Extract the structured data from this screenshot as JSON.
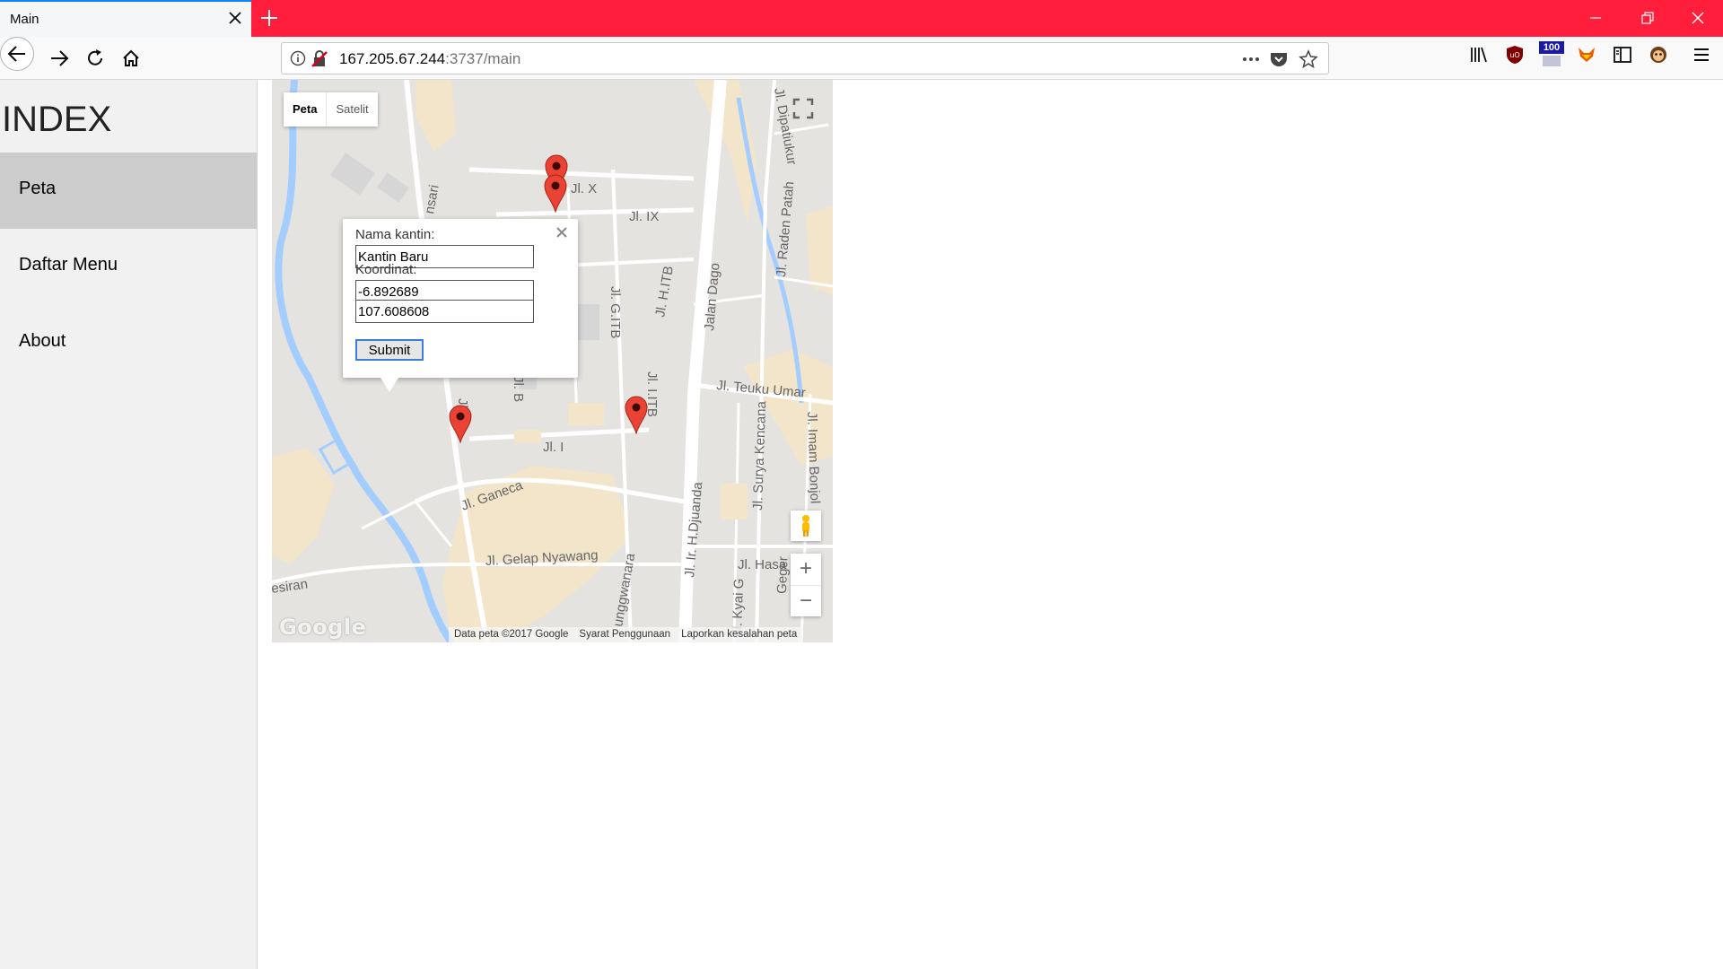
{
  "browser": {
    "tab_title": "Main",
    "url_host": "167.205.67.244",
    "url_rest": ":3737/main",
    "badge_count": "100"
  },
  "sidebar": {
    "title": "INDEX",
    "items": [
      {
        "label": "Peta",
        "active": true
      },
      {
        "label": "Daftar Menu",
        "active": false
      },
      {
        "label": "About",
        "active": false
      }
    ]
  },
  "map": {
    "type_buttons": [
      "Peta",
      "Satelit"
    ],
    "selected_type": "Peta",
    "zoom_in": "+",
    "zoom_out": "−",
    "logo": "Google",
    "attribution": [
      "Data peta ©2017 Google",
      "Syarat Penggunaan",
      "Laporkan kesalahan peta"
    ],
    "street_labels": [
      "Jl. X",
      "Jl. IX",
      "Jl. G.ITB",
      "Jl. H.ITB",
      "Jalan Dago",
      "Jl. Dipatiukur",
      "Jl. Raden Patah",
      "Jl. Teuku Umar",
      "Jl. Surya Kencana",
      "Jl. Imam Bonjol",
      "Jl. I",
      "Jl. I.ITB",
      "Jl. B",
      "Jl. Ganeca",
      "Jl. Gelap Nyawang",
      "Jl. Ir. H.Djuanda",
      "Jl. Hasa",
      "Jl. Kyai G",
      "unggwanara",
      "esiran",
      "nsari",
      "Jl. C",
      "Geger"
    ]
  },
  "info_window": {
    "name_label": "Nama kantin:",
    "name_value": "Kantin Baru",
    "coord_label": "Koordinat:",
    "lat_value": "-6.892689",
    "lng_value": "107.608608",
    "submit_label": "Submit"
  },
  "colors": {
    "tabstrip": "#ff1f3d",
    "marker": "#ea4335",
    "sidebar_active": "#cccccc",
    "map_water": "#a3ccff",
    "map_park": "#f2e5c9"
  }
}
